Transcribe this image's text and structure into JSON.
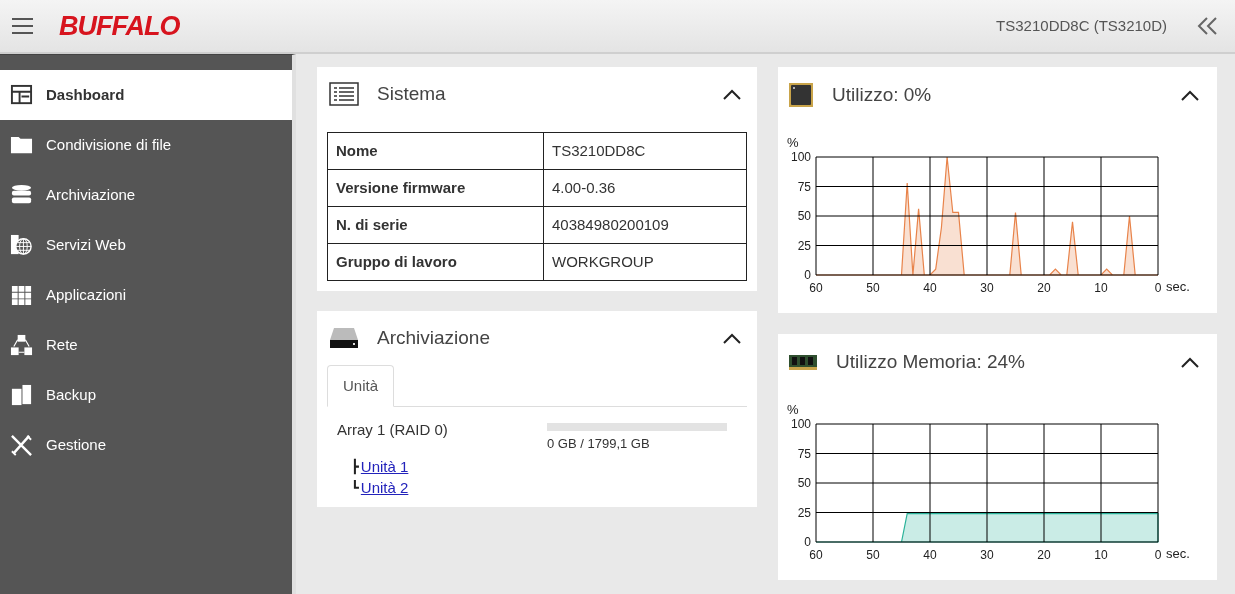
{
  "header": {
    "logo": "BUFFALO",
    "device": "TS3210DD8C (TS3210D)"
  },
  "sidebar": {
    "items": [
      {
        "label": "Dashboard",
        "selected": true
      },
      {
        "label": "Condivisione di file",
        "selected": false
      },
      {
        "label": "Archiviazione",
        "selected": false
      },
      {
        "label": "Servizi Web",
        "selected": false
      },
      {
        "label": "Applicazioni",
        "selected": false
      },
      {
        "label": "Rete",
        "selected": false
      },
      {
        "label": "Backup",
        "selected": false
      },
      {
        "label": "Gestione",
        "selected": false
      }
    ]
  },
  "system_card": {
    "title": "Sistema",
    "rows": [
      {
        "label": "Nome",
        "value": "TS3210DD8C"
      },
      {
        "label": "Versione firmware",
        "value": "4.00-0.36"
      },
      {
        "label": "N. di serie",
        "value": "40384980200109"
      },
      {
        "label": "Gruppo di lavoro",
        "value": "WORKGROUP"
      }
    ]
  },
  "storage_card": {
    "title": "Archiviazione",
    "tabs": [
      {
        "label": "Unità",
        "selected": true
      }
    ],
    "array": {
      "name": "Array 1 (RAID 0)",
      "level": 0,
      "usage": "0 GB / 1799,1 GB",
      "children": [
        {
          "branch": "┣",
          "label": "Unità 1"
        },
        {
          "branch": "┗",
          "label": "Unità 2"
        }
      ]
    }
  },
  "cpu_card": {
    "title": "Utilizzo: 0%",
    "chart_data": {
      "type": "area",
      "grid": true,
      "ylabel": "%",
      "xlabel": "sec.",
      "x": [
        60,
        45,
        44,
        43,
        42,
        41,
        40,
        39,
        38,
        37,
        36,
        35,
        34,
        26,
        25,
        24,
        19,
        18,
        17,
        16,
        15,
        14,
        10,
        9,
        8,
        6,
        5,
        4,
        0
      ],
      "series": [
        {
          "color": "#e8834a",
          "values": [
            0,
            0,
            78,
            0,
            56,
            0,
            0,
            5,
            40,
            100,
            53,
            53,
            0,
            0,
            53,
            0,
            0,
            5,
            0,
            0,
            45,
            0,
            0,
            5,
            0,
            0,
            50,
            0,
            0
          ]
        }
      ],
      "xlim": [
        60,
        0
      ],
      "ylim": [
        0,
        100
      ],
      "xticks": [
        60,
        50,
        40,
        30,
        20,
        10,
        0
      ],
      "yticks": [
        0,
        25,
        50,
        75,
        100
      ]
    }
  },
  "memory_card": {
    "title": "Utilizzo Memoria: 24%",
    "chart_data": {
      "type": "area",
      "grid": true,
      "ylabel": "%",
      "xlabel": "sec.",
      "x": [
        60,
        45,
        44,
        0
      ],
      "series": [
        {
          "color": "#2bb39a",
          "values": [
            0,
            0,
            24,
            24
          ]
        }
      ],
      "xlim": [
        60,
        0
      ],
      "ylim": [
        0,
        100
      ],
      "xticks": [
        60,
        50,
        40,
        30,
        20,
        10,
        0
      ],
      "yticks": [
        0,
        25,
        50,
        75,
        100
      ]
    }
  }
}
